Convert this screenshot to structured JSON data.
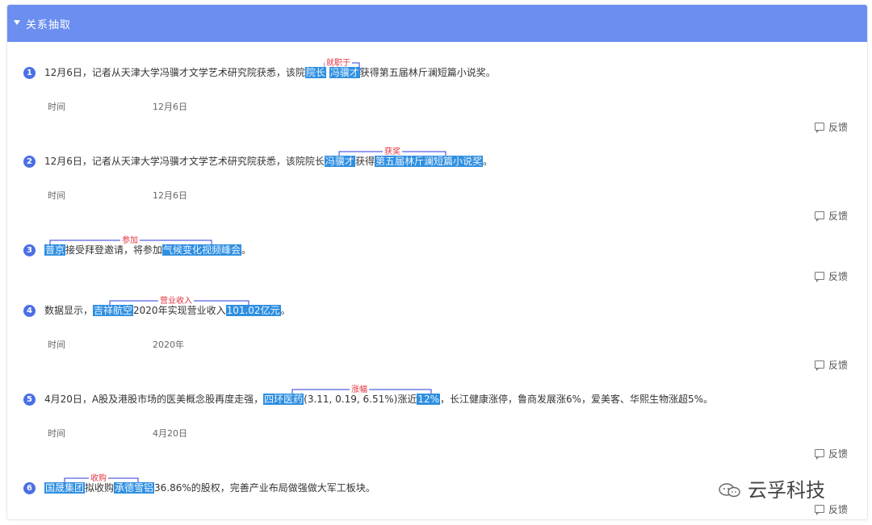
{
  "panel": {
    "title": "关系抽取"
  },
  "items": [
    {
      "num": "1",
      "parts": [
        "12月6日，记者从天津大学冯骥才文学艺术研究院获悉，该院",
        "院长",
        " ",
        "冯骥才",
        "获得第五届林斤澜短篇小说奖。"
      ],
      "relation": "就职于",
      "meta_label": "时间",
      "meta_value": "12月6日",
      "feedback": "反馈"
    },
    {
      "num": "2",
      "parts": [
        "12月6日，记者从天津大学冯骥才文学艺术研究院获悉，该院院长",
        "冯骥才",
        "获得",
        "第五届林斤澜短篇小说奖",
        "。"
      ],
      "relation": "获奖",
      "meta_label": "时间",
      "meta_value": "12月6日",
      "feedback": "反馈"
    },
    {
      "num": "3",
      "parts": [
        "",
        "普京",
        "接受拜登邀请，将参加",
        "气候变化视频峰会",
        "。"
      ],
      "relation": "参加",
      "feedback": "反馈"
    },
    {
      "num": "4",
      "parts": [
        "数据显示，",
        "吉祥航空",
        "2020年实现营业收入",
        "101.02亿元",
        "。"
      ],
      "relation": "营业收入",
      "meta_label": "时间",
      "meta_value": "2020年",
      "feedback": "反馈"
    },
    {
      "num": "5",
      "parts": [
        "4月20日，A股及港股市场的医美概念股再度走强，",
        "四环医药",
        "(3.11, 0.19, 6.51%)涨近",
        "12%",
        "，长江健康涨停，鲁商发展涨6%，爱美客、华熙生物涨超5%。"
      ],
      "relation": "涨幅",
      "meta_label": "时间",
      "meta_value": "4月20日",
      "feedback": "反馈"
    },
    {
      "num": "6",
      "parts": [
        "",
        "国晟集团",
        "拟收购",
        "承德雪铝",
        "36.86%的股权，完善产业布局做强做大军工板块。"
      ],
      "relation": "收购",
      "feedback": "反馈"
    }
  ],
  "watermark": "云孚科技",
  "colors": {
    "header": "#6b8ef0",
    "entity": "#2f8fe0",
    "relation": "#e0333f",
    "number_badge": "#4a6fe6"
  }
}
